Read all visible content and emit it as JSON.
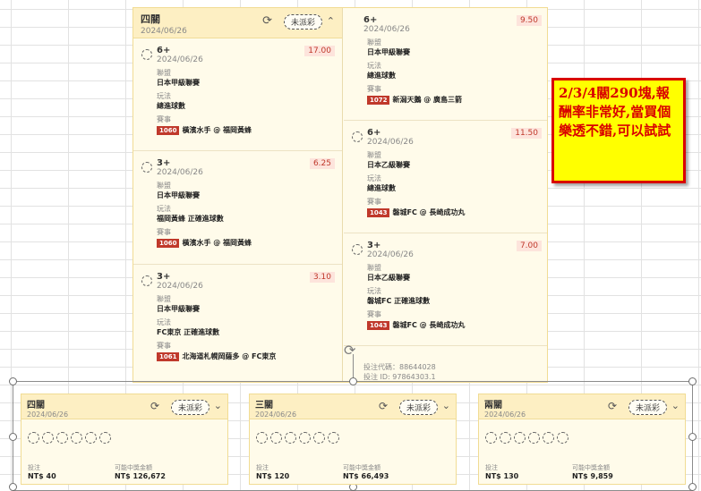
{
  "main_panel": {
    "title": "四關",
    "date": "2024/06/26",
    "status_pill": "未派彩",
    "left_entries": [
      {
        "title": "6+",
        "date": "2024/06/26",
        "odds": "17.00",
        "league_label": "聯盟",
        "league": "日本甲級聯賽",
        "play_label": "玩法",
        "play": "總進球數",
        "match_label": "賽事",
        "match_code": "1060",
        "match": "橫濱水手 @ 福岡黃蜂"
      },
      {
        "title": "3+",
        "date": "2024/06/26",
        "odds": "6.25",
        "league_label": "聯盟",
        "league": "日本甲級聯賽",
        "play_label": "玩法",
        "play": "福岡黃蜂 正確進球數",
        "match_label": "賽事",
        "match_code": "1060",
        "match": "橫濱水手 @ 福岡黃蜂"
      },
      {
        "title": "3+",
        "date": "2024/06/26",
        "odds": "3.10",
        "league_label": "聯盟",
        "league": "日本甲級聯賽",
        "play_label": "玩法",
        "play": "FC東京 正確進球數",
        "match_label": "賽事",
        "match_code": "1061",
        "match": "北海道札幌岡薩多 @ FC東京"
      }
    ],
    "right_entries": [
      {
        "title": "6+",
        "date": "2024/06/26",
        "odds": "9.50",
        "league_label": "聯盟",
        "league": "日本甲級聯賽",
        "play_label": "玩法",
        "play": "總進球數",
        "match_label": "賽事",
        "match_code": "1072",
        "match": "新潟天鵝 @ 廣島三箭"
      },
      {
        "title": "6+",
        "date": "2024/06/26",
        "odds": "11.50",
        "league_label": "聯盟",
        "league": "日本乙級聯賽",
        "play_label": "玩法",
        "play": "總進球數",
        "match_label": "賽事",
        "match_code": "1043",
        "match": "磐城FC @ 長崎成功丸"
      },
      {
        "title": "3+",
        "date": "2024/06/26",
        "odds": "7.00",
        "league_label": "聯盟",
        "league": "日本乙級聯賽",
        "play_label": "玩法",
        "play": "磐城FC 正確進球數",
        "match_label": "賽事",
        "match_code": "1043",
        "match": "磐城FC @ 長崎成功丸"
      }
    ],
    "bet_code": "投注代碼：88644028",
    "bet_id": "投注 ID: 97864303.1"
  },
  "callout_text": "2/3/4關290塊,報酬率非常好,當買個樂透不錯,可以試試",
  "cards": [
    {
      "title": "四關",
      "date": "2024/06/26",
      "status_pill": "未派彩",
      "stake_label": "投注",
      "stake": "NT$ 40",
      "payout_label": "可能中獎金額",
      "payout": "NT$ 126,672"
    },
    {
      "title": "三關",
      "date": "2024/06/26",
      "status_pill": "未派彩",
      "stake_label": "投注",
      "stake": "NT$ 120",
      "payout_label": "可能中獎金額",
      "payout": "NT$ 66,493"
    },
    {
      "title": "兩關",
      "date": "2024/06/26",
      "status_pill": "未派彩",
      "stake_label": "投注",
      "stake": "NT$ 130",
      "payout_label": "可能中獎金額",
      "payout": "NT$ 9,859"
    }
  ]
}
